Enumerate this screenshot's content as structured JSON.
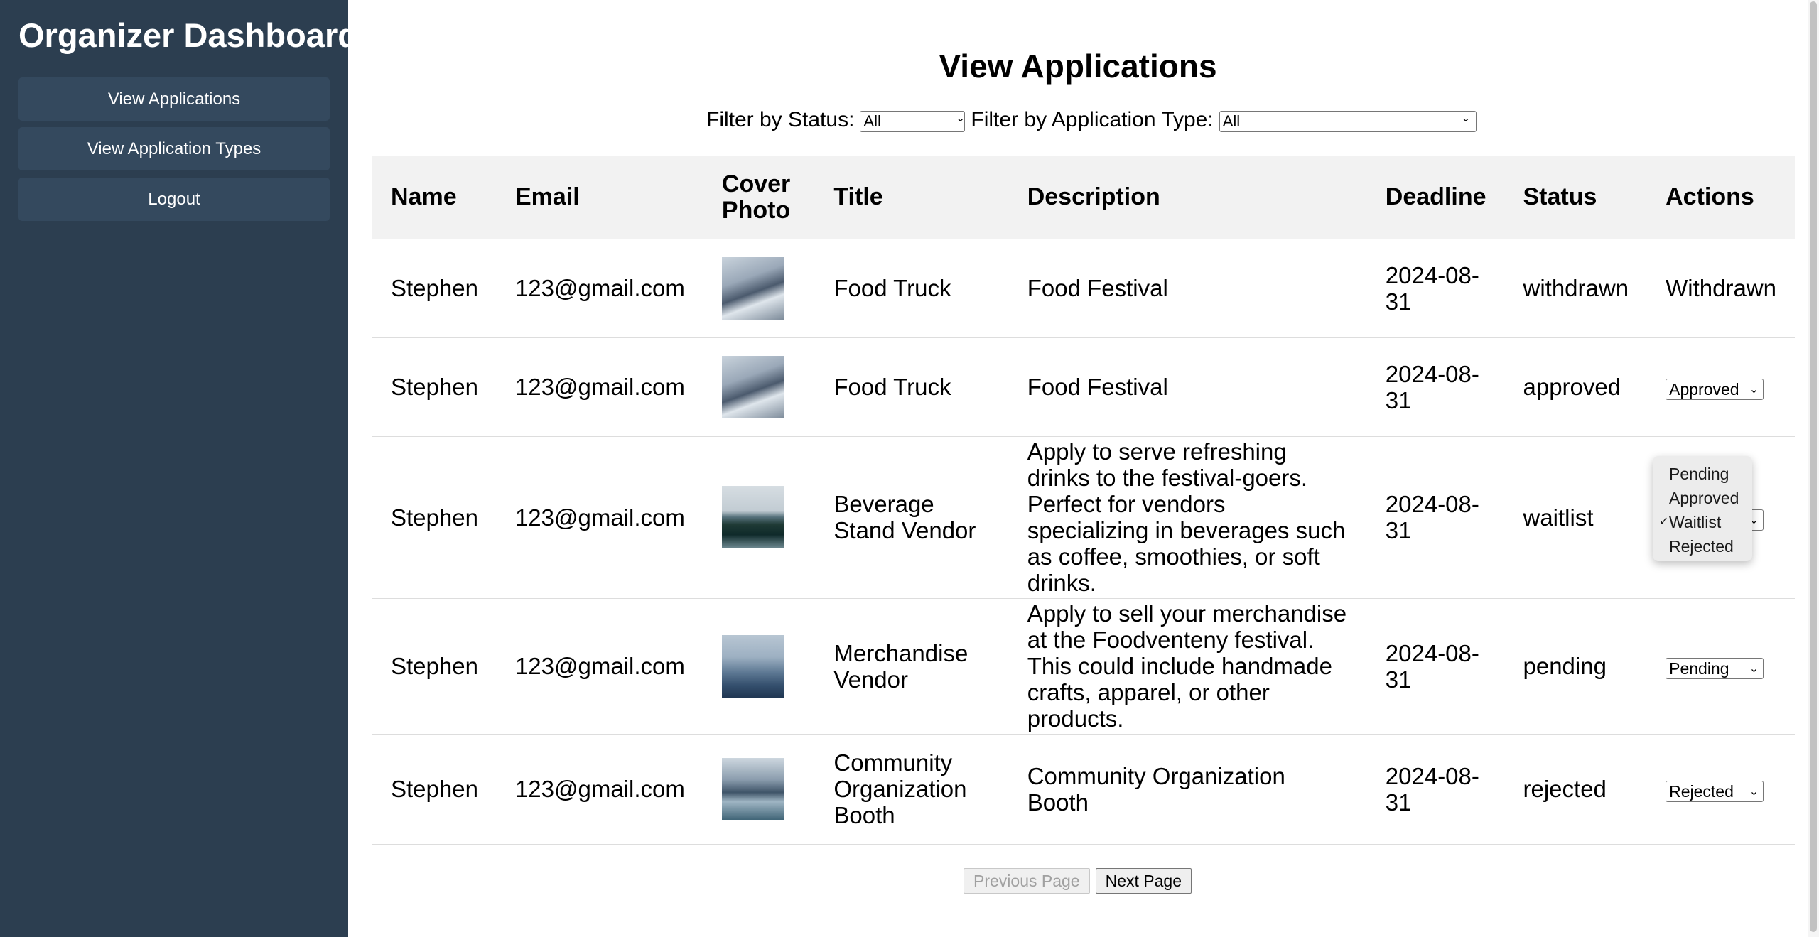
{
  "sidebar": {
    "title": "Organizer Dashboard",
    "items": [
      {
        "label": "View Applications"
      },
      {
        "label": "View Application Types"
      },
      {
        "label": "Logout"
      }
    ]
  },
  "main": {
    "title": "View Applications",
    "filters": {
      "status_label": "Filter by Status:",
      "status_value": "All",
      "type_label": "Filter by Application Type:",
      "type_value": "All"
    },
    "table": {
      "headers": [
        "Name",
        "Email",
        "Cover Photo",
        "Title",
        "Description",
        "Deadline",
        "Status",
        "Actions"
      ],
      "rows": [
        {
          "name": "Stephen",
          "email": "123@gmail.com",
          "photo_icon": "snowy-mountain-image",
          "title": "Food Truck",
          "description": "Food Festival",
          "deadline": "2024-08-31",
          "status": "withdrawn",
          "action_text": "Withdrawn"
        },
        {
          "name": "Stephen",
          "email": "123@gmail.com",
          "photo_icon": "snowy-mountain-image",
          "title": "Food Truck",
          "description": "Food Festival",
          "deadline": "2024-08-31",
          "status": "approved",
          "action_select": "Approved"
        },
        {
          "name": "Stephen",
          "email": "123@gmail.com",
          "photo_icon": "forest-lake-image",
          "title": "Beverage Stand Vendor",
          "description": "Apply to serve refreshing drinks to the festival-goers. Perfect for vendors specializing in beverages such as coffee, smoothies, or soft drinks.",
          "deadline": "2024-08-31",
          "status": "waitlist",
          "action_select": "Waitlist"
        },
        {
          "name": "Stephen",
          "email": "123@gmail.com",
          "photo_icon": "foggy-mountains-image",
          "title": "Merchandise Vendor",
          "description": "Apply to sell your merchandise at the Foodventeny festival. This could include handmade crafts, apparel, or other products.",
          "deadline": "2024-08-31",
          "status": "pending",
          "action_select": "Pending"
        },
        {
          "name": "Stephen",
          "email": "123@gmail.com",
          "photo_icon": "mountain-lake-image",
          "title": "Community Organization Booth",
          "description": "Community Organization Booth",
          "deadline": "2024-08-31",
          "status": "rejected",
          "action_select": "Rejected"
        }
      ]
    },
    "dropdown": {
      "options": [
        "Pending",
        "Approved",
        "Waitlist",
        "Rejected"
      ],
      "selected": "Waitlist",
      "check": "✓"
    },
    "pagination": {
      "prev_label": "Previous Page",
      "next_label": "Next Page"
    }
  }
}
